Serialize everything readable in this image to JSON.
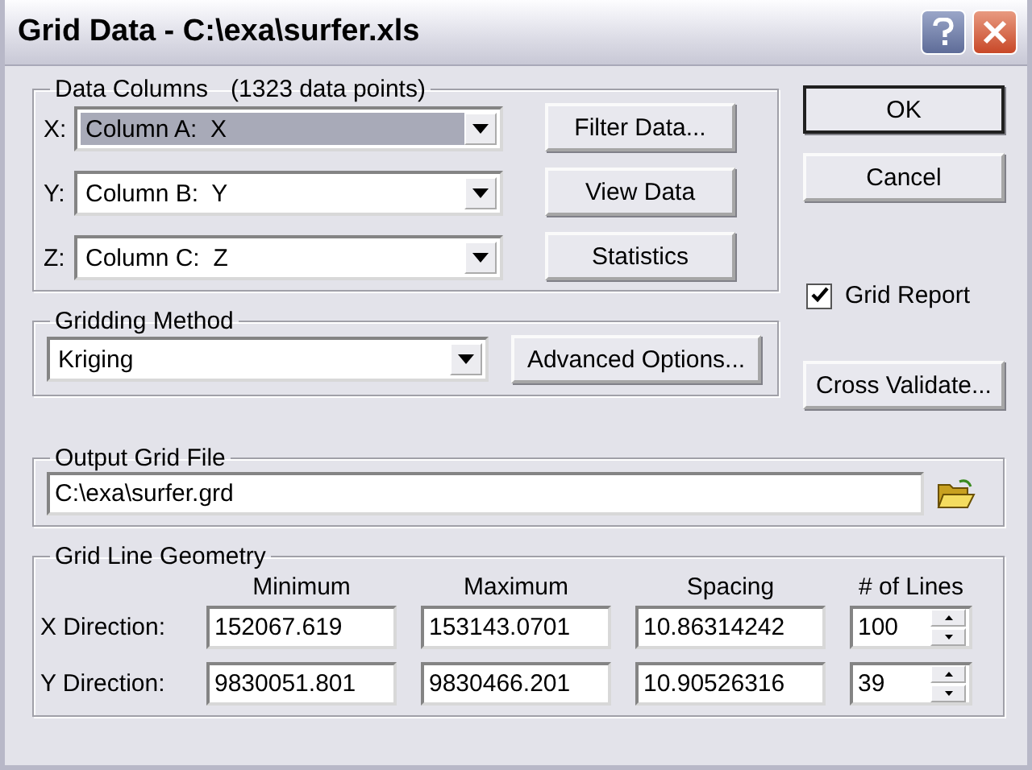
{
  "window": {
    "title": "Grid Data - C:\\exa\\surfer.xls"
  },
  "data_columns": {
    "title": "Data Columns",
    "count": "(1323 data points)",
    "rows": [
      {
        "axis": "X:",
        "value": "Column A:  X",
        "selected": true
      },
      {
        "axis": "Y:",
        "value": "Column B:  Y",
        "selected": false
      },
      {
        "axis": "Z:",
        "value": "Column C:  Z",
        "selected": false
      }
    ],
    "buttons": [
      "Filter Data...",
      "View Data",
      "Statistics"
    ]
  },
  "dialog_buttons": [
    "OK",
    "Cancel"
  ],
  "grid_report": {
    "label": "Grid Report",
    "checked": true
  },
  "gridding_method": {
    "title": "Gridding Method",
    "value": "Kriging",
    "button": "Advanced Options..."
  },
  "cross_validate": "Cross Validate...",
  "output_grid_file": {
    "title": "Output Grid File",
    "value": "C:\\exa\\surfer.grd"
  },
  "grid_line_geometry": {
    "title": "Grid Line Geometry",
    "columns": [
      "Minimum",
      "Maximum",
      "Spacing",
      "# of Lines"
    ],
    "rows": [
      {
        "label": "X Direction:",
        "values": [
          "152067.619",
          "153143.0701",
          "10.86314242",
          "100"
        ]
      },
      {
        "label": "Y Direction:",
        "values": [
          "9830051.801",
          "9830466.201",
          "10.90526316",
          "39"
        ]
      }
    ]
  }
}
